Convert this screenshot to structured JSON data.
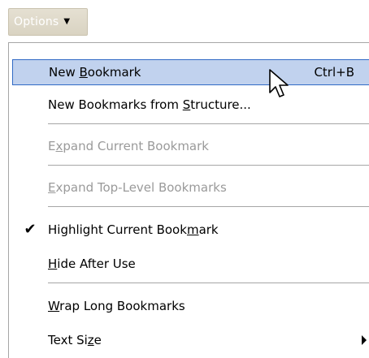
{
  "options_button": {
    "label": "Options",
    "caret_icon": "triangle-down-icon"
  },
  "menu": {
    "new_bookmark": {
      "pre": "New ",
      "acc": "B",
      "post": "ookmark",
      "shortcut": "Ctrl+B"
    },
    "new_from_structure": {
      "pre": "New Bookmarks from ",
      "acc": "S",
      "post": "tructure..."
    },
    "expand_current": {
      "pre": "E",
      "acc": "x",
      "post": "pand Current Bookmark"
    },
    "expand_top": {
      "pre": "",
      "acc": "E",
      "post": "xpand Top-Level Bookmarks"
    },
    "highlight_current": {
      "pre": "Highlight Current Book",
      "acc": "m",
      "post": "ark",
      "checked": true,
      "check_icon": "checkmark-icon"
    },
    "hide_after_use": {
      "pre": "",
      "acc": "H",
      "post": "ide After Use"
    },
    "wrap_long": {
      "pre": "",
      "acc": "W",
      "post": "rap Long Bookmarks"
    },
    "text_size": {
      "pre": "Text Si",
      "acc": "z",
      "post": "e",
      "submenu_icon": "submenu-arrow-icon"
    }
  },
  "colors": {
    "highlight_bg": "#c1d2ee",
    "highlight_border": "#316ac5",
    "disabled_text": "#9a9a9a"
  }
}
